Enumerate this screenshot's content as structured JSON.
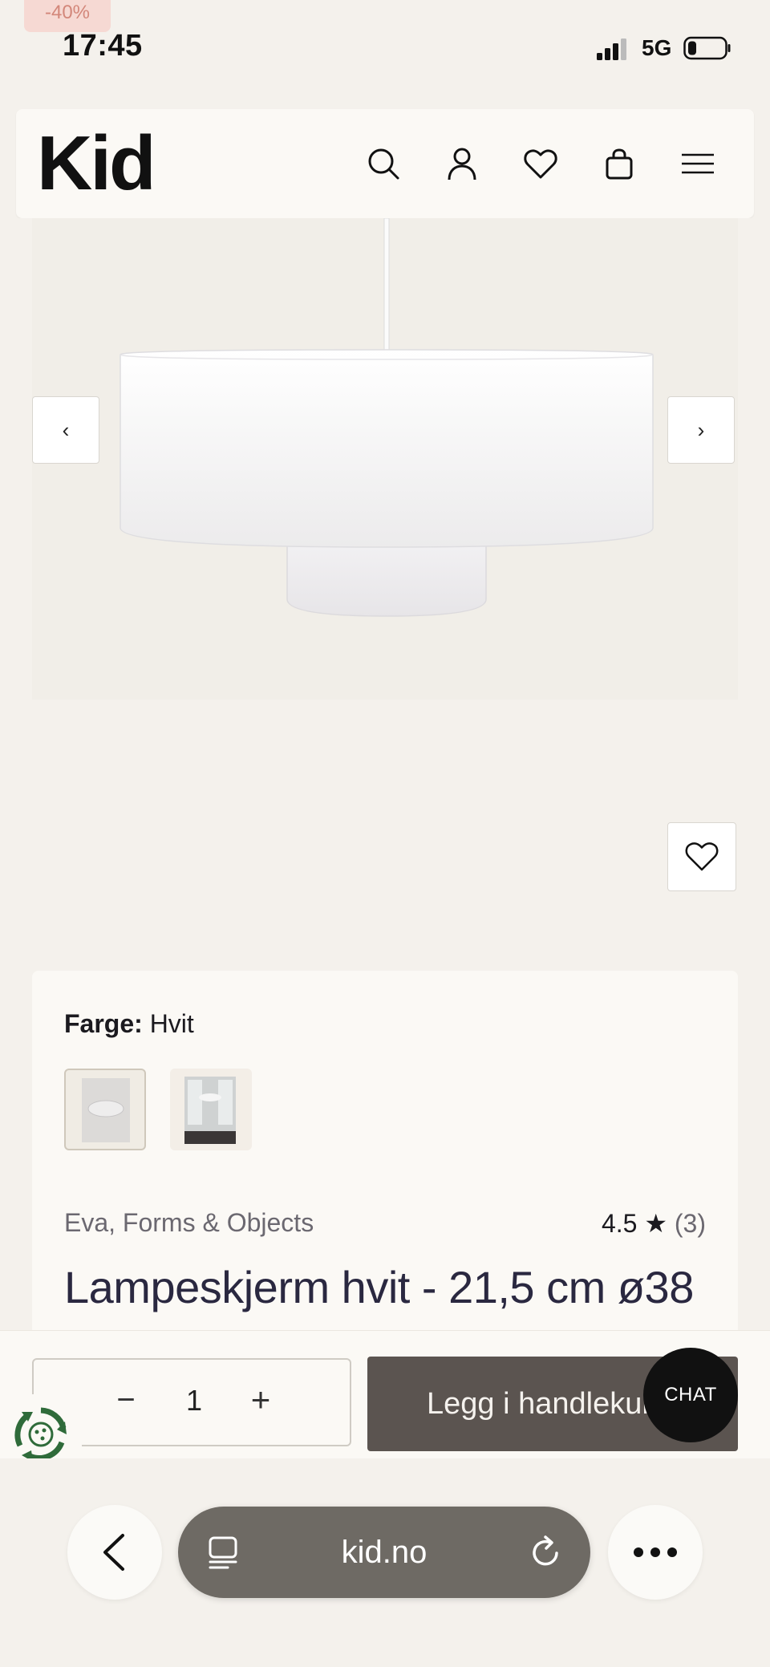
{
  "status_bar": {
    "time": "17:45",
    "network": "5G",
    "discount_chip": "-40%"
  },
  "header": {
    "logo": "Kid",
    "icons": [
      "search-icon",
      "account-icon",
      "wishlist-icon",
      "cart-icon",
      "menu-icon"
    ]
  },
  "gallery": {
    "prev_label": "‹",
    "next_label": "›"
  },
  "product": {
    "color_label": "Farge:",
    "color_value": "Hvit",
    "brand": "Eva, Forms & Objects",
    "rating": "4.5",
    "rating_star": "★",
    "review_count": "(3)",
    "title": "Lampeskjerm hvit - 21,5 cm ø38"
  },
  "purchase": {
    "minus_label": "−",
    "quantity": "1",
    "plus_label": "+",
    "add_to_cart": "Legg i handlekurv",
    "chat_label": "CHAT"
  },
  "browser": {
    "url": "kid.no"
  },
  "colors": {
    "background": "#f4f1ec",
    "card": "#fbf9f5",
    "accent_button": "#5b5450",
    "chat": "#111111",
    "eco_green": "#2f6b3a"
  }
}
